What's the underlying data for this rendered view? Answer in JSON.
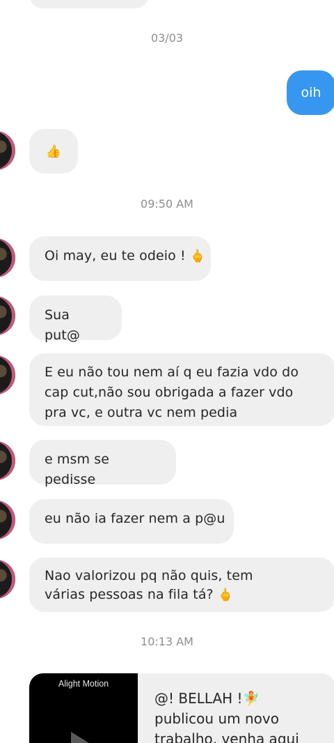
{
  "timestamps": {
    "date": "03/03",
    "time1": "09:50 AM",
    "time2": "10:13 AM"
  },
  "outgoing": {
    "message": "oih"
  },
  "incoming": {
    "thumb_emoji": "👍",
    "messages": [
      {
        "text": "Oi may, eu te odeio !",
        "emoji": "🖕"
      },
      {
        "text": "Sua put@",
        "emoji": ""
      },
      {
        "text": "E eu não tou nem aí q eu fazia vdo do cap cut,não sou obrigada a fazer vdo pra vc, e outra vc nem pedia",
        "emoji": ""
      },
      {
        "text": "e msm se pedisse",
        "emoji": ""
      },
      {
        "text": "eu não ia fazer nem a p@u",
        "emoji": ""
      },
      {
        "text": "Nao valorizou pq não quis, tem várias pessoas na fila tá?",
        "emoji": "🖕"
      }
    ]
  },
  "shared_post": {
    "thumb_label": "Alight Motion",
    "text_line1": "@! BELLAH !🧚",
    "text_line2": "publicou um novo",
    "text_line3": "trabalho, venha aqui"
  },
  "colors": {
    "outgoing_bubble": "#3797f0",
    "incoming_bubble": "#efefef",
    "timestamp": "#8e8e8e"
  }
}
